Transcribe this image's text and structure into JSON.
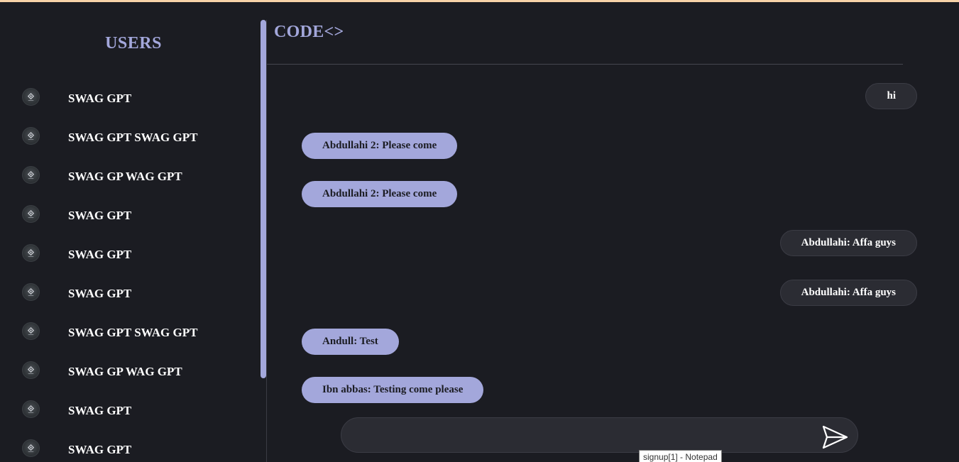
{
  "sidebar": {
    "title": "USERS",
    "users": [
      {
        "name": "SWAG GPT"
      },
      {
        "name": "SWAG GPT SWAG GPT"
      },
      {
        "name": "SWAG GP WAG GPT"
      },
      {
        "name": "SWAG GPT"
      },
      {
        "name": "SWAG GPT"
      },
      {
        "name": "SWAG GPT"
      },
      {
        "name": "SWAG GPT SWAG GPT"
      },
      {
        "name": "SWAG GP WAG GPT"
      },
      {
        "name": "SWAG GPT"
      },
      {
        "name": "SWAG GPT"
      }
    ]
  },
  "chat": {
    "title": "CODE<>",
    "messages": [
      {
        "text": "hi",
        "direction": "outgoing"
      },
      {
        "text": "Abdullahi 2: Please come",
        "direction": "incoming"
      },
      {
        "text": "Abdullahi 2: Please come",
        "direction": "incoming"
      },
      {
        "text": "Abdullahi: Affa guys",
        "direction": "outgoing"
      },
      {
        "text": "Abdullahi: Affa guys",
        "direction": "outgoing"
      },
      {
        "text": "Andull: Test",
        "direction": "incoming"
      },
      {
        "text": "Ibn abbas: Testing come please",
        "direction": "incoming"
      }
    ],
    "input": {
      "value": "",
      "placeholder": ""
    },
    "send_icon": "send-arrow-icon"
  },
  "tooltip": {
    "text": "signup[1] - Notepad"
  },
  "colors": {
    "background": "#1b1c22",
    "accent": "#a3a7db",
    "outgoing_bubble": "#2b2c33",
    "top_line": "#f7d2a8"
  }
}
